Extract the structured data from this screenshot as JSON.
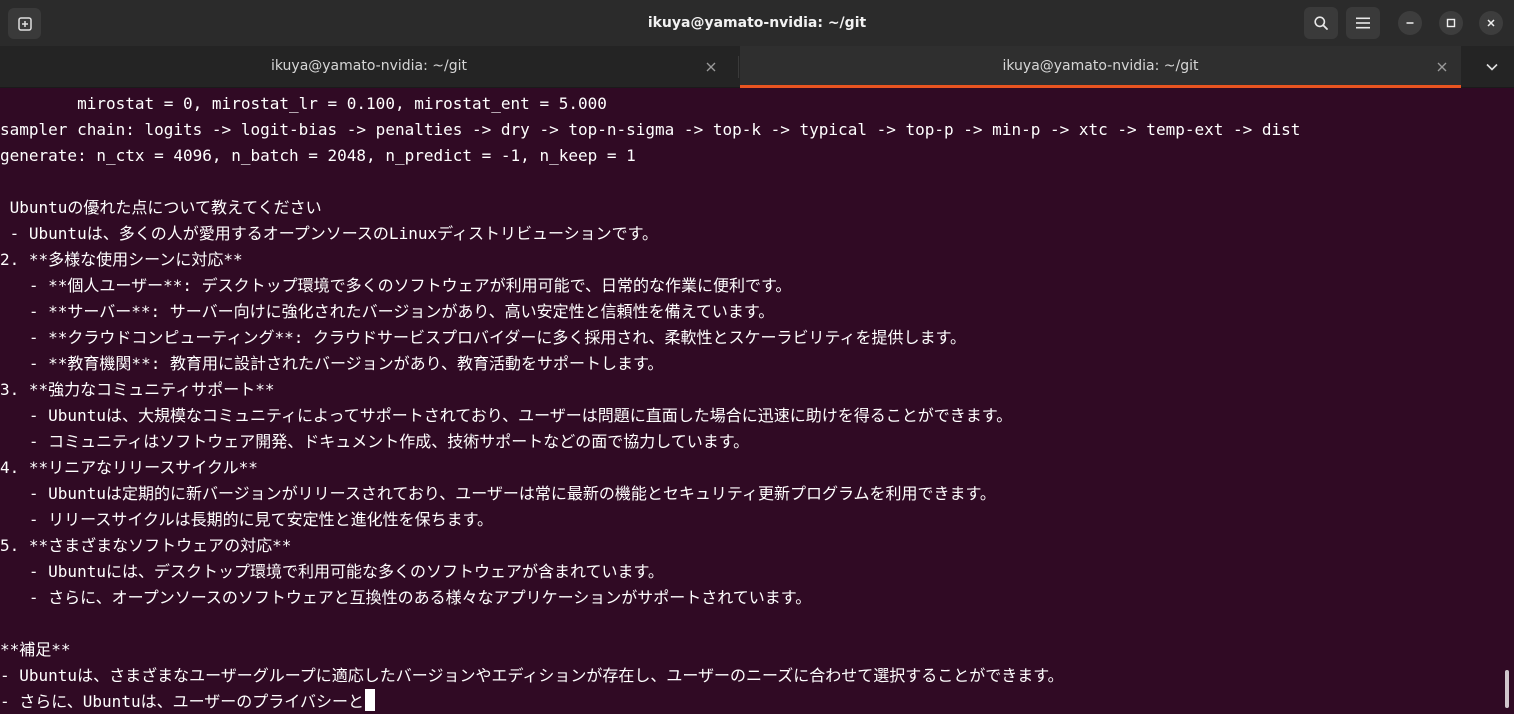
{
  "window": {
    "title": "ikuya@yamato-nvidia: ~/git"
  },
  "icons": {
    "new_tab": "new-tab-icon",
    "search": "search-icon",
    "menu": "hamburger-menu-icon",
    "minimize": "minimize-icon",
    "maximize": "maximize-icon",
    "close": "close-icon",
    "tab_close": "close-icon",
    "tab_dropdown": "chevron-down-icon"
  },
  "colors": {
    "terminal_bg": "#300a24",
    "active_tab_accent": "#e95420",
    "text": "#ffffff"
  },
  "tabs": [
    {
      "label": "ikuya@yamato-nvidia: ~/git",
      "active": false
    },
    {
      "label": "ikuya@yamato-nvidia: ~/git",
      "active": true
    }
  ],
  "terminal": {
    "lines": [
      "        mirostat = 0, mirostat_lr = 0.100, mirostat_ent = 5.000",
      "sampler chain: logits -> logit-bias -> penalties -> dry -> top-n-sigma -> top-k -> typical -> top-p -> min-p -> xtc -> temp-ext -> dist",
      "generate: n_ctx = 4096, n_batch = 2048, n_predict = -1, n_keep = 1",
      "",
      " Ubuntuの優れた点について教えてください",
      " - Ubuntuは、多くの人が愛用するオープンソースのLinuxディストリビューションです。",
      "2. **多様な使用シーンに対応**",
      "   - **個人ユーザー**: デスクトップ環境で多くのソフトウェアが利用可能で、日常的な作業に便利です。",
      "   - **サーバー**: サーバー向けに強化されたバージョンがあり、高い安定性と信頼性を備えています。",
      "   - **クラウドコンピューティング**: クラウドサービスプロバイダーに多く採用され、柔軟性とスケーラビリティを提供します。",
      "   - **教育機関**: 教育用に設計されたバージョンがあり、教育活動をサポートします。",
      "3. **強力なコミュニティサポート**",
      "   - Ubuntuは、大規模なコミュニティによってサポートされており、ユーザーは問題に直面した場合に迅速に助けを得ることができます。",
      "   - コミュニティはソフトウェア開発、ドキュメント作成、技術サポートなどの面で協力しています。",
      "4. **リニアなリリースサイクル**",
      "   - Ubuntuは定期的に新バージョンがリリースされており、ユーザーは常に最新の機能とセキュリティ更新プログラムを利用できます。",
      "   - リリースサイクルは長期的に見て安定性と進化性を保ちます。",
      "5. **さまざまなソフトウェアの対応**",
      "   - Ubuntuには、デスクトップ環境で利用可能な多くのソフトウェアが含まれています。",
      "   - さらに、オープンソースのソフトウェアと互換性のある様々なアプリケーションがサポートされています。",
      "",
      "**補足**",
      "- Ubuntuは、さまざまなユーザーグループに適応したバージョンやエディションが存在し、ユーザーのニーズに合わせて選択することができます。",
      "- さらに、Ubuntuは、ユーザーのプライバシーと"
    ]
  }
}
